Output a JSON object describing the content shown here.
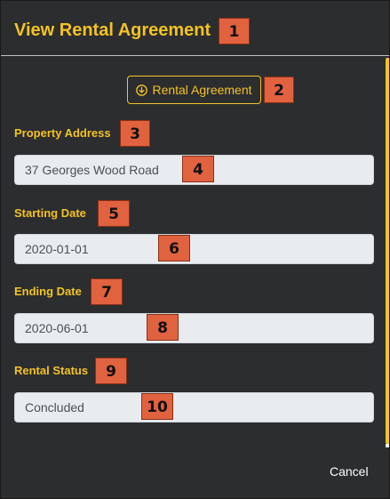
{
  "modal": {
    "title": "View Rental Agreement",
    "download_button_label": "Rental Agreement",
    "download_icon": "download-circle-icon",
    "cancel_label": "Cancel"
  },
  "fields": [
    {
      "label": "Property Address",
      "value": "37 Georges Wood Road"
    },
    {
      "label": "Starting Date",
      "value": "2020-01-01"
    },
    {
      "label": "Ending Date",
      "value": "2020-06-01"
    },
    {
      "label": "Rental Status",
      "value": "Concluded"
    }
  ],
  "annotations": [
    "1",
    "2",
    "3",
    "4",
    "5",
    "6",
    "7",
    "8",
    "9",
    "10"
  ],
  "colors": {
    "accent": "#f3c325",
    "background": "#2c2d2f",
    "field_background": "#e9ecef",
    "badge": "#e0623f"
  }
}
